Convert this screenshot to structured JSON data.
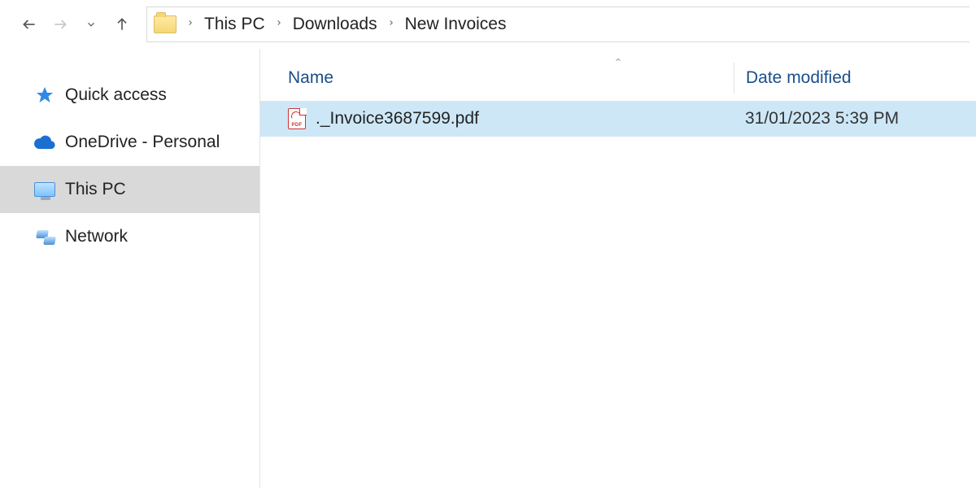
{
  "breadcrumb": [
    "This PC",
    "Downloads",
    "New Invoices"
  ],
  "sidebar": {
    "items": [
      {
        "id": "quick-access",
        "label": "Quick access"
      },
      {
        "id": "onedrive",
        "label": "OneDrive - Personal"
      },
      {
        "id": "this-pc",
        "label": "This PC"
      },
      {
        "id": "network",
        "label": "Network"
      }
    ],
    "selected": "this-pc"
  },
  "columns": {
    "name": "Name",
    "date": "Date modified"
  },
  "files": [
    {
      "name": "._Invoice3687599.pdf",
      "modified": "31/01/2023 5:39 PM",
      "selected": true
    }
  ]
}
